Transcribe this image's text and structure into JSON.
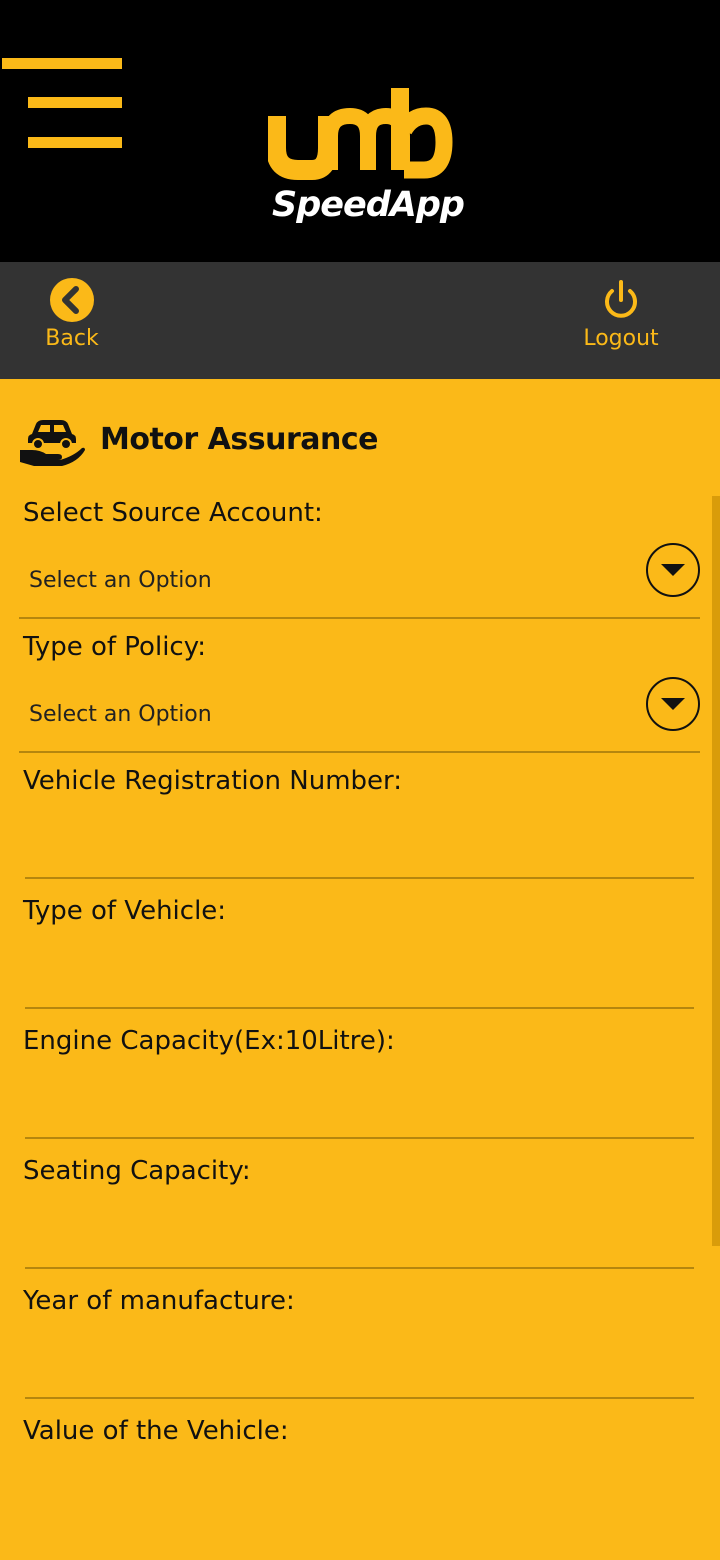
{
  "app": {
    "logo_sub": "SpeedApp",
    "colors": {
      "accent": "#fbb918",
      "header_bg": "#000000",
      "nav_bg": "#333333"
    }
  },
  "nav": {
    "back_label": "Back",
    "logout_label": "Logout",
    "icons": {
      "back": "chevron-left-circle",
      "logout": "power"
    }
  },
  "page": {
    "title": "Motor Assurance",
    "title_icon": "car-in-hand"
  },
  "form": {
    "source_account": {
      "label": "Select Source Account:",
      "value": "Select an Option"
    },
    "policy_type": {
      "label": "Type of Policy:",
      "value": "Select an Option"
    },
    "registration": {
      "label": "Vehicle Registration Number:",
      "value": ""
    },
    "vehicle_type": {
      "label": "Type of Vehicle:",
      "value": ""
    },
    "engine_capacity": {
      "label": "Engine Capacity(Ex:10Litre):",
      "value": ""
    },
    "seating_capacity": {
      "label": "Seating Capacity:",
      "value": ""
    },
    "year_of_manufacture": {
      "label": "Year of manufacture:",
      "value": ""
    },
    "vehicle_value": {
      "label": "Value of the Vehicle:",
      "value": ""
    }
  }
}
